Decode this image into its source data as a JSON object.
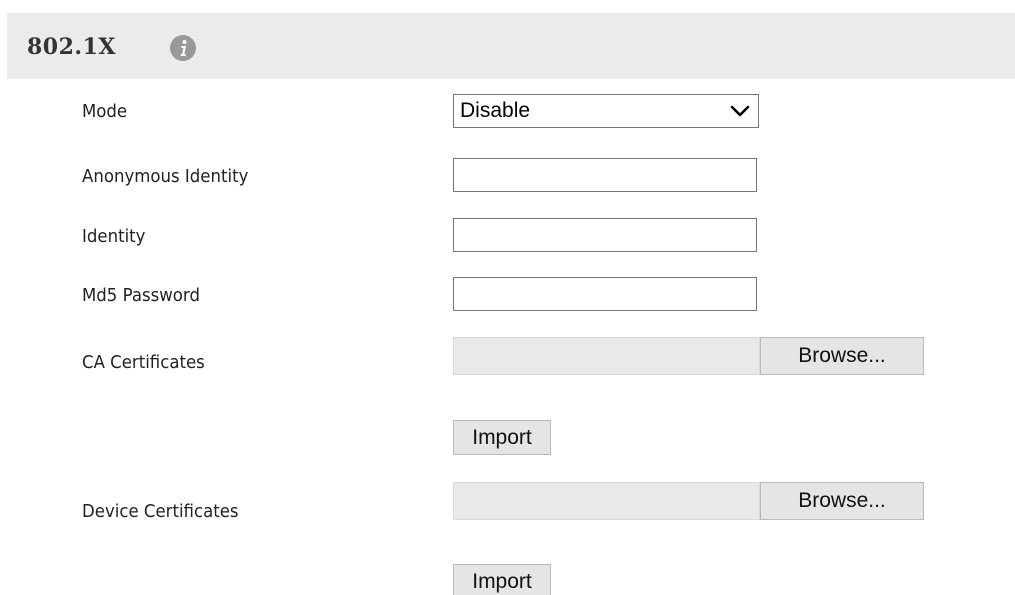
{
  "header": {
    "title": "802.1X",
    "info_icon": "info-icon"
  },
  "form": {
    "mode": {
      "label": "Mode",
      "value": "Disable",
      "chevron_icon": "chevron-down-icon"
    },
    "anonymous_identity": {
      "label": "Anonymous Identity",
      "value": ""
    },
    "identity": {
      "label": "Identity",
      "value": ""
    },
    "md5_password": {
      "label": "Md5 Password",
      "value": ""
    },
    "ca_certificates": {
      "label": "CA Certificates",
      "browse_label": "Browse...",
      "import_label": "Import"
    },
    "device_certificates": {
      "label": "Device Certificates",
      "browse_label": "Browse...",
      "import_label": "Import"
    }
  },
  "colors": {
    "header_background": "#ebebeb",
    "info_icon": "#999999",
    "input_border": "#777777",
    "file_field_background": "#e9e9e9",
    "button_background": "#e5e5e5"
  }
}
